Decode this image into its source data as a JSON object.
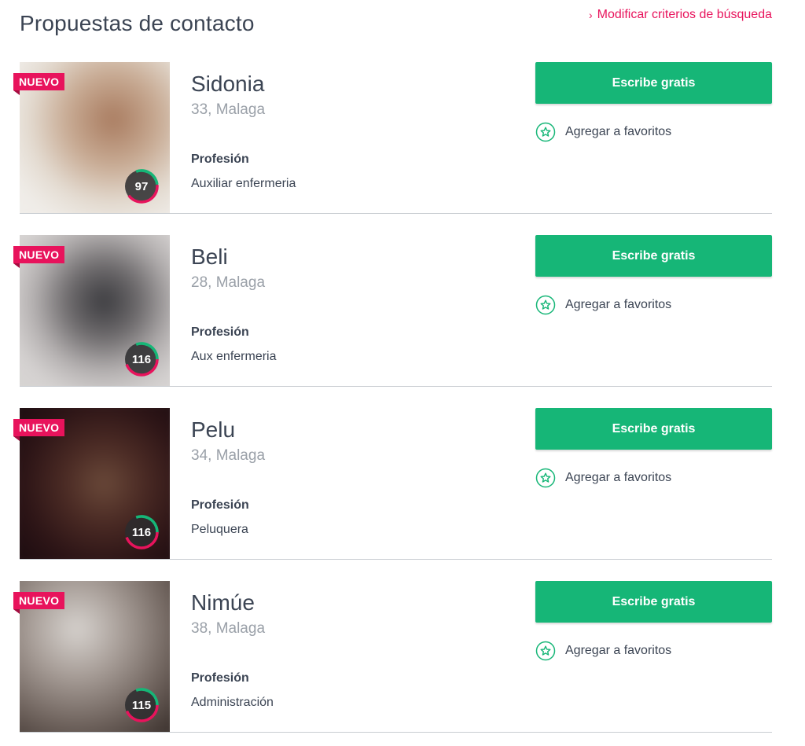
{
  "header": {
    "title": "Propuestas de contacto",
    "modify_link": "Modificar criterios de búsqueda"
  },
  "colors": {
    "accent_pink": "#e8135c",
    "action_green": "#16b677",
    "text_dark": "#3b4453",
    "text_muted": "#9aa0a8"
  },
  "cards": [
    {
      "badge": "NUEVO",
      "name": "Sidonia",
      "age_city": "33, Malaga",
      "profession_label": "Profesión",
      "profession": "Auxiliar enfermeria",
      "score": "97",
      "cta": "Escribe gratis",
      "favorite_label": "Agregar a favoritos"
    },
    {
      "badge": "NUEVO",
      "name": "Beli",
      "age_city": "28, Malaga",
      "profession_label": "Profesión",
      "profession": "Aux enfermeria",
      "score": "116",
      "cta": "Escribe gratis",
      "favorite_label": "Agregar a favoritos"
    },
    {
      "badge": "NUEVO",
      "name": "Pelu",
      "age_city": "34, Malaga",
      "profession_label": "Profesión",
      "profession": "Peluquera",
      "score": "116",
      "cta": "Escribe gratis",
      "favorite_label": "Agregar a favoritos"
    },
    {
      "badge": "NUEVO",
      "name": "Nimúe",
      "age_city": "38, Malaga",
      "profession_label": "Profesión",
      "profession": "Administración",
      "score": "115",
      "cta": "Escribe gratis",
      "favorite_label": "Agregar a favoritos"
    }
  ]
}
